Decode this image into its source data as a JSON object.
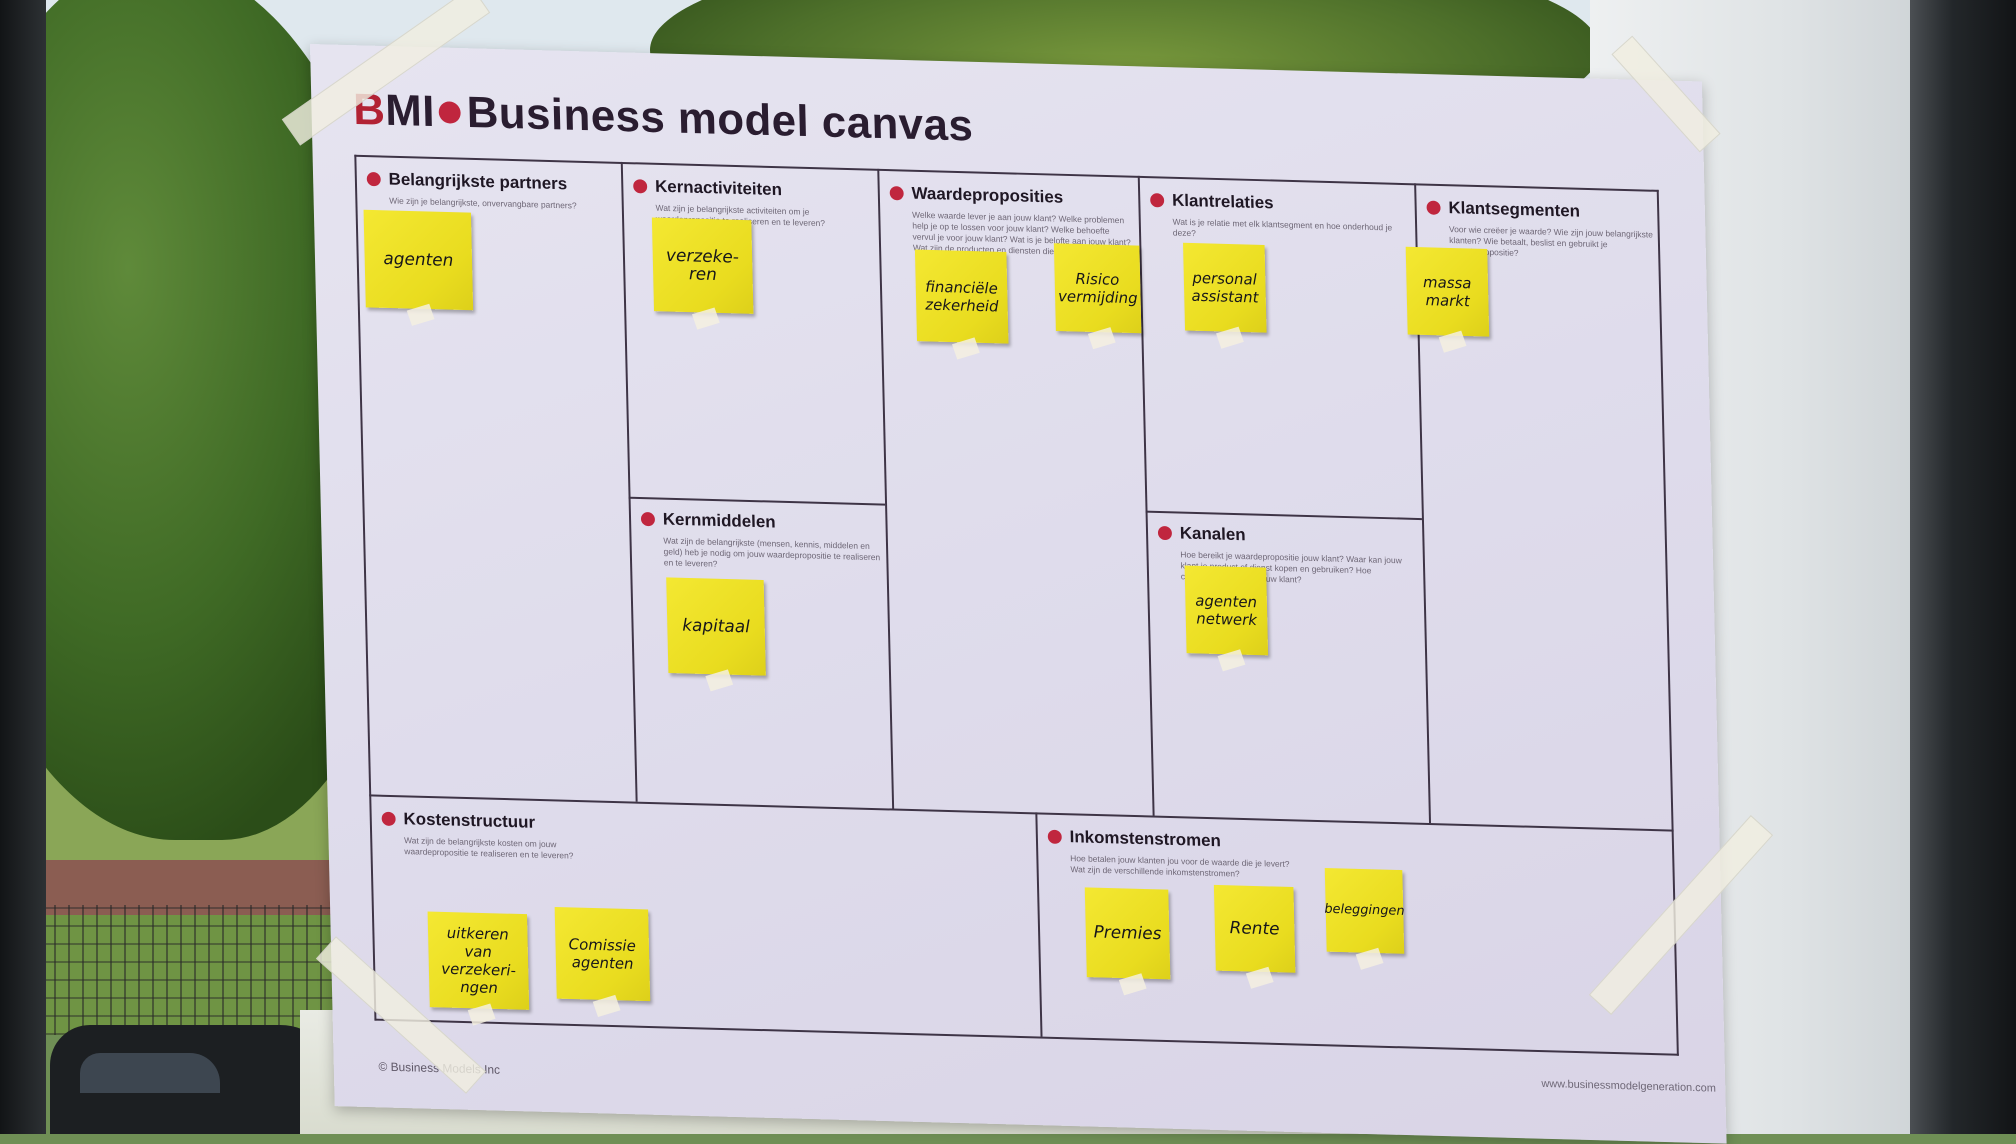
{
  "poster": {
    "logo_b": "B",
    "logo_mi": "MI",
    "title": "Business model canvas",
    "copyright": "© Business Models Inc",
    "url": "www.businessmodelgeneration.com",
    "accent_color": "#c0263e"
  },
  "sections": {
    "partners": {
      "title": "Belangrijkste partners",
      "question": "Wie zijn je belangrijkste, onvervangbare partners?"
    },
    "activities": {
      "title": "Kernactiviteiten",
      "question": "Wat zijn je belangrijkste activiteiten om je waardepropositie te realiseren en te leveren?"
    },
    "resources": {
      "title": "Kernmiddelen",
      "question": "Wat zijn de belangrijkste (mensen, kennis, middelen en geld) heb je nodig om jouw waardepropositie te realiseren en te leveren?"
    },
    "value": {
      "title": "Waardeproposities",
      "question": "Welke waarde lever je aan jouw klant? Welke problemen help je op te lossen voor jouw klant? Welke behoefte vervul je voor jouw klant? Wat is je belofte aan jouw klant? Wat zijn de producten en diensten die je levert?"
    },
    "relations": {
      "title": "Klantrelaties",
      "question": "Wat is je relatie met elk klantsegment en hoe onderhoud je deze?"
    },
    "channels": {
      "title": "Kanalen",
      "question": "Hoe bereikt je waardepropositie jouw klant? Waar kan jouw klant je product of dienst kopen en gebruiken? Hoe communiceer je met jouw klant?"
    },
    "segments": {
      "title": "Klantsegmenten",
      "question": "Voor wie creëer je waarde? Wie zijn jouw belangrijkste klanten? Wie betaalt, beslist en gebruikt je waardepropositie?"
    },
    "costs": {
      "title": "Kostenstructuur",
      "question": "Wat zijn de belangrijkste kosten om jouw waardepropositie te realiseren en te leveren?"
    },
    "revenue": {
      "title": "Inkomstenstromen",
      "question": "Hoe betalen jouw klanten jou voor de waarde die je levert? Wat zijn de verschillende inkomstenstromen?"
    }
  },
  "notes": {
    "agenten": "agenten",
    "verzekeren": "verzeke-ren",
    "kapitaal": "kapitaal",
    "financiele": "financiële zekerheid",
    "risico": "Risico vermijding",
    "personal": "personal assistant",
    "agentennetwerk": "agenten netwerk",
    "massamarkt": "massa markt",
    "premies": "Premies",
    "rente": "Rente",
    "beleggingen": "beleggingen",
    "uitkeren": "uitkeren van verzekeri-ngen",
    "commissie": "Comissie agenten"
  }
}
